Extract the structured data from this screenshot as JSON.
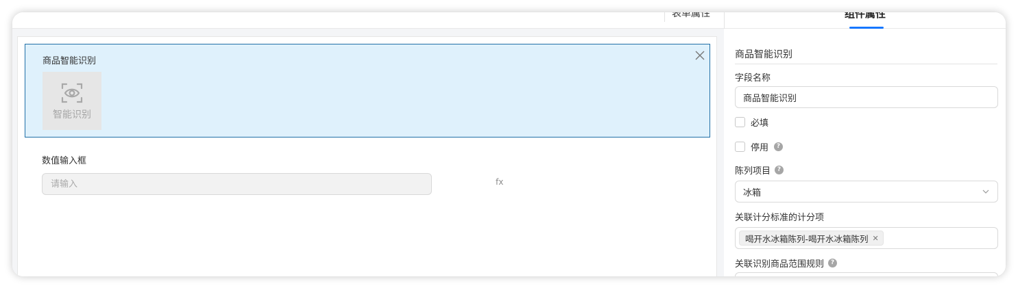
{
  "tabs": {
    "form_props": "表单属性",
    "component_props": "组件属性"
  },
  "canvas": {
    "selected_field": {
      "title": "商品智能识别",
      "tile_label": "智能识别",
      "tile_icon": "eye-scan-icon",
      "close_icon": "close-icon"
    },
    "number_field": {
      "title": "数值输入框",
      "placeholder": "请输入",
      "fx_label": "fx"
    }
  },
  "panel": {
    "heading": "商品智能识别",
    "field_name_label": "字段名称",
    "field_name_value": "商品智能识别",
    "required_label": "必填",
    "disabled_label": "停用",
    "display_item_label": "陈列项目",
    "display_item_value": "冰箱",
    "scoring_label": "关联计分标准的计分项",
    "scoring_tags": [
      "喝开水冰箱陈列-喝开水冰箱陈列"
    ],
    "range_rule_label": "关联识别商品范围规则",
    "help_glyph": "?"
  },
  "colors": {
    "accent": "#1677ff",
    "selected_bg": "#dff1fc",
    "selected_border": "#1f6ea6"
  }
}
